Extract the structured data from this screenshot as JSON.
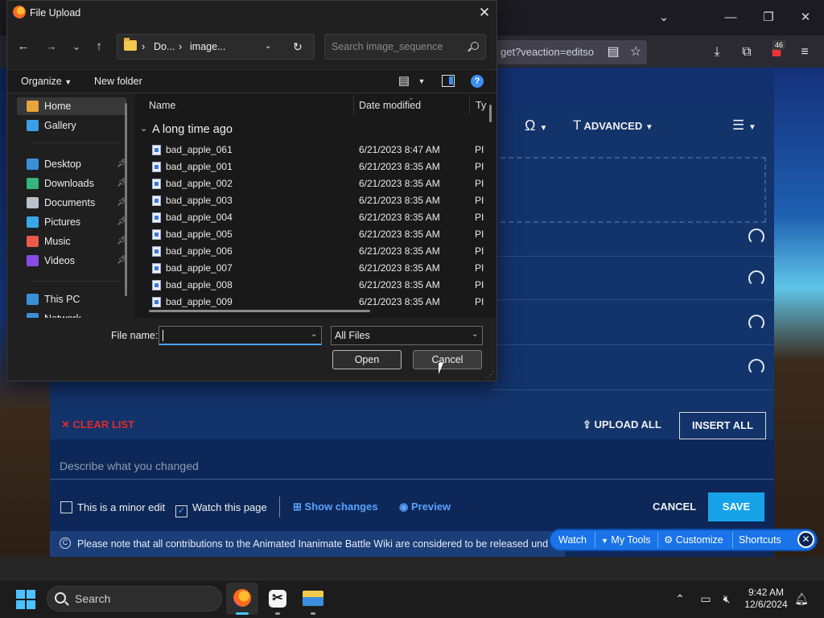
{
  "browser": {
    "url_fragment": "get?veaction=editso",
    "extension_badge": "46"
  },
  "editor": {
    "toolbar": {
      "special_char": "Ω",
      "advanced_label": "ADVANCED"
    },
    "clear_list_label": "CLEAR LIST",
    "upload_all_label": "UPLOAD ALL",
    "insert_all_label": "INSERT ALL",
    "summary_placeholder": "Describe what you changed",
    "minor_edit_label": "This is a minor edit",
    "minor_edit_checked": false,
    "watch_label": "Watch this page",
    "watch_checked": true,
    "show_changes_label": "Show changes",
    "preview_label": "Preview",
    "cancel_label": "CANCEL",
    "save_label": "SAVE",
    "notice_text": "Please note that all contributions to the Animated Inanimate Battle Wiki are considered to be released und"
  },
  "favorites_bar": {
    "items": [
      "Watch",
      "My Tools",
      "Customize",
      "Shortcuts"
    ]
  },
  "taskbar": {
    "search_label": "Search",
    "time": "9:42 AM",
    "date": "12/6/2024"
  },
  "dialog": {
    "title": "File Upload",
    "path": [
      "Do...",
      "image..."
    ],
    "search_placeholder": "Search image_sequence",
    "organize_label": "Organize",
    "new_folder_label": "New folder",
    "nav_items": [
      {
        "label": "Home",
        "icon": "home-icon",
        "pinned": false,
        "color": "#e8a33a"
      },
      {
        "label": "Gallery",
        "icon": "gallery-icon",
        "pinned": false,
        "color": "#3aa0e8"
      },
      {
        "label": "Desktop",
        "icon": "desktop-icon",
        "pinned": true,
        "color": "#3a8fd8"
      },
      {
        "label": "Downloads",
        "icon": "downloads-icon",
        "pinned": true,
        "color": "#35b57a"
      },
      {
        "label": "Documents",
        "icon": "documents-icon",
        "pinned": true,
        "color": "#b8c2cc"
      },
      {
        "label": "Pictures",
        "icon": "pictures-icon",
        "pinned": true,
        "color": "#3aa8e8"
      },
      {
        "label": "Music",
        "icon": "music-icon",
        "pinned": true,
        "color": "#e85a4a"
      },
      {
        "label": "Videos",
        "icon": "videos-icon",
        "pinned": true,
        "color": "#8a4ae8"
      },
      {
        "label": "This PC",
        "icon": "this-pc-icon",
        "pinned": false,
        "color": "#3a8fd8"
      },
      {
        "label": "Network",
        "icon": "network-icon",
        "pinned": false,
        "color": "#3a8fd8"
      }
    ],
    "columns": {
      "name": "Name",
      "date": "Date modified",
      "type": "Ty"
    },
    "group_label": "A long time ago",
    "files": [
      {
        "name": "bad_apple_061",
        "date": "6/21/2023 8:47 AM",
        "type": "PI"
      },
      {
        "name": "bad_apple_001",
        "date": "6/21/2023 8:35 AM",
        "type": "PI"
      },
      {
        "name": "bad_apple_002",
        "date": "6/21/2023 8:35 AM",
        "type": "PI"
      },
      {
        "name": "bad_apple_003",
        "date": "6/21/2023 8:35 AM",
        "type": "PI"
      },
      {
        "name": "bad_apple_004",
        "date": "6/21/2023 8:35 AM",
        "type": "PI"
      },
      {
        "name": "bad_apple_005",
        "date": "6/21/2023 8:35 AM",
        "type": "PI"
      },
      {
        "name": "bad_apple_006",
        "date": "6/21/2023 8:35 AM",
        "type": "PI"
      },
      {
        "name": "bad_apple_007",
        "date": "6/21/2023 8:35 AM",
        "type": "PI"
      },
      {
        "name": "bad_apple_008",
        "date": "6/21/2023 8:35 AM",
        "type": "PI"
      },
      {
        "name": "bad_apple_009",
        "date": "6/21/2023 8:35 AM",
        "type": "PI"
      }
    ],
    "file_name_label": "File name:",
    "file_name_value": "",
    "file_type_value": "All Files",
    "open_label": "Open",
    "cancel_label": "Cancel"
  }
}
